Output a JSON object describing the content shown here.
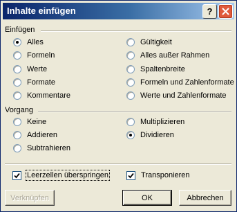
{
  "window": {
    "title": "Inhalte einfügen",
    "help_symbol": "?",
    "close_icon": "close-icon"
  },
  "einfuegen": {
    "label": "Einfügen",
    "options": [
      {
        "label": "Alles",
        "selected": true
      },
      {
        "label": "Formeln",
        "selected": false
      },
      {
        "label": "Werte",
        "selected": false
      },
      {
        "label": "Formate",
        "selected": false
      },
      {
        "label": "Kommentare",
        "selected": false
      },
      {
        "label": "Gültigkeit",
        "selected": false
      },
      {
        "label": "Alles außer Rahmen",
        "selected": false
      },
      {
        "label": "Spaltenbreite",
        "selected": false
      },
      {
        "label": "Formeln und Zahlenformate",
        "selected": false
      },
      {
        "label": "Werte und Zahlenformate",
        "selected": false
      }
    ]
  },
  "vorgang": {
    "label": "Vorgang",
    "options": [
      {
        "label": "Keine",
        "selected": false
      },
      {
        "label": "Addieren",
        "selected": false
      },
      {
        "label": "Subtrahieren",
        "selected": false
      },
      {
        "label": "Multiplizieren",
        "selected": false
      },
      {
        "label": "Dividieren",
        "selected": true
      }
    ]
  },
  "checkboxes": {
    "skip_blanks": {
      "label": "Leerzellen überspringen",
      "checked": true
    },
    "transpose": {
      "label": "Transponieren",
      "checked": true
    }
  },
  "buttons": {
    "link": "Verknüpfen",
    "ok": "OK",
    "cancel": "Abbrechen"
  }
}
